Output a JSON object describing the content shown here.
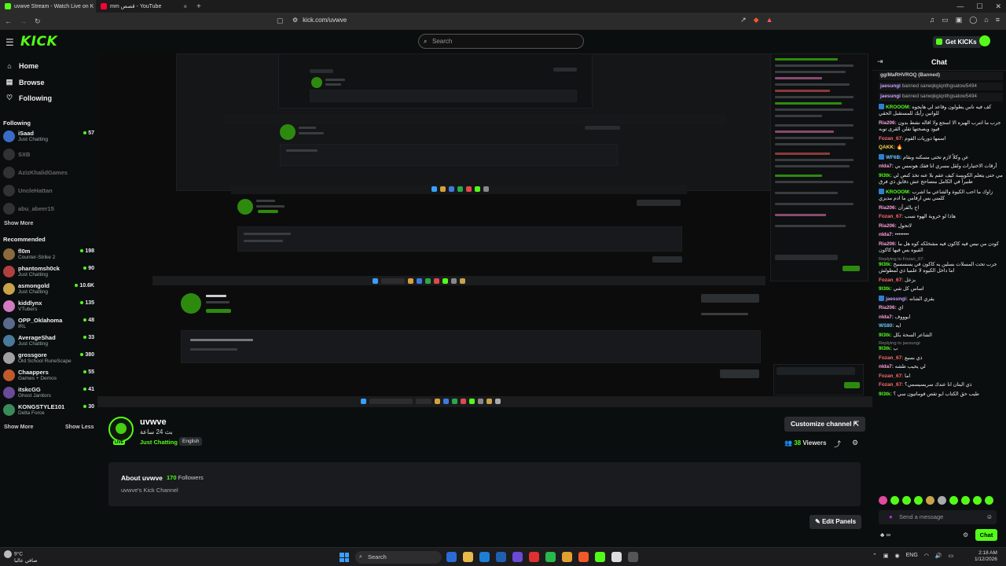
{
  "browser": {
    "tabs": [
      {
        "title": "uvwve Stream - Watch Live on K",
        "color": "#53fc18"
      },
      {
        "title": "mm قصص - YouTube",
        "color": "#ff0033"
      }
    ],
    "url": "kick.com/uvwve"
  },
  "header": {
    "logo": "KICK",
    "search_placeholder": "Search",
    "get_kicks": "Get KICKs"
  },
  "sidebar": {
    "nav": [
      {
        "label": "Home",
        "icon": "home-icon"
      },
      {
        "label": "Browse",
        "icon": "browse-icon"
      },
      {
        "label": "Following",
        "icon": "heart-icon"
      }
    ],
    "following_title": "Following",
    "following": [
      {
        "name": "iSaad",
        "category": "Just Chatting",
        "viewers": "57",
        "live": true,
        "color": "#3a6bc9"
      },
      {
        "name": "SXB",
        "category": "",
        "viewers": "",
        "live": false,
        "color": "#777"
      },
      {
        "name": "AzizKhalidGames",
        "category": "",
        "viewers": "",
        "live": false,
        "color": "#777"
      },
      {
        "name": "UncleHattan",
        "category": "",
        "viewers": "",
        "live": false,
        "color": "#777"
      },
      {
        "name": "abu_abeer15",
        "category": "",
        "viewers": "",
        "live": false,
        "color": "#777"
      }
    ],
    "show_more": "Show More",
    "recommended_title": "Recommended",
    "recommended": [
      {
        "name": "fl0m",
        "category": "Counter-Strike 2",
        "viewers": "198",
        "color": "#8a6a3a"
      },
      {
        "name": "phantomsh0ck",
        "category": "Just Chatting",
        "viewers": "90",
        "color": "#b04040"
      },
      {
        "name": "asmongold",
        "category": "Just Chatting",
        "viewers": "10.6K",
        "color": "#c9a24a"
      },
      {
        "name": "kiddlynx",
        "category": "VTubers",
        "viewers": "135",
        "color": "#d07ac0"
      },
      {
        "name": "OPP_Oklahoma",
        "category": "IRL",
        "viewers": "48",
        "color": "#5a6a8a"
      },
      {
        "name": "AverageShad",
        "category": "Just Chatting",
        "viewers": "33",
        "color": "#4a7a9a"
      },
      {
        "name": "grossgore",
        "category": "Old School RuneScape",
        "viewers": "380",
        "color": "#a0a0a0"
      },
      {
        "name": "Chaappers",
        "category": "Games + Demos",
        "viewers": "55",
        "color": "#c05a2a"
      },
      {
        "name": "itskcGG",
        "category": "Ghost Janitors",
        "viewers": "41",
        "color": "#6a4a9a"
      },
      {
        "name": "KONGSTYLE101",
        "category": "Delta Force",
        "viewers": "30",
        "color": "#3a8a5a"
      }
    ],
    "show_more_2": "Show More",
    "show_less": "Show Less"
  },
  "channel": {
    "name": "uvwve",
    "title": "بث 24 ساعة",
    "category": "Just Chatting",
    "language": "English",
    "live_badge": "LIVE",
    "customize": "Customize channel",
    "viewers_count": "38",
    "viewers_label": "Viewers",
    "about_title": "About uvwve",
    "followers_count": "170",
    "followers_label": "Followers",
    "about_desc": "uvwve's Kick Channel",
    "edit_panels": "Edit Panels"
  },
  "chat": {
    "title": "Chat",
    "messages": [
      {
        "user": "gg/MaRHVROQ (Banned)",
        "text": "",
        "color": "#cfcfcf",
        "system": true
      },
      {
        "user": "jaesungi",
        "text": "banned sarwqkgiqnthgsatow5494",
        "color": "#c9a0ff",
        "system": true
      },
      {
        "user": "jaesungi",
        "text": "banned sarwqkgiqnthgsatow5494",
        "color": "#c9a0ff",
        "system": true
      },
      {
        "user": "KROOOM:",
        "text": "كف فيه ناس يطولون وقاعد لي هايجوه للوانين رأيك للمستقبل الحقي",
        "color": "#53fc18",
        "badge": true
      },
      {
        "user": "Ria206:",
        "text": "جرب ما اتنرب الهيزه الا اسجع ولا اقاله نشط بدون قيود وبصحتها تقلن القرى توبه",
        "color": "#ff9fdc"
      },
      {
        "user": "Fozan_67:",
        "text": "اسمها دوريات القوم",
        "color": "#ff6b6b"
      },
      {
        "user": "QAKK:",
        "text": "🔥",
        "color": "#ffd84a"
      },
      {
        "user": "WF6B:",
        "text": "عن وكلاً لازم تختى مسكنه وبقام",
        "color": "#6ac7ff",
        "badge": true
      },
      {
        "user": "nIda7:",
        "text": "أرقات الاختيارات ولقل مسري انا فقك هونمس بي",
        "color": "#ff9fdc"
      },
      {
        "user": "9l3tk:",
        "text": "مي حتى يتعلم الكويسة كيف عقم بلا عنه تخذ كنص لي ظنيراً في الكامل متصاحج عش دقايق ذي فرق",
        "color": "#53fc18"
      },
      {
        "user": "KROOOM:",
        "text": "زاوك ما احب الكيوة والشاعي ما اشرب كلمني بس ارقامن ما ادم مديزي",
        "color": "#53fc18",
        "badge": true
      },
      {
        "user": "Ria206:",
        "text": "اج بالقرآن",
        "color": "#ff9fdc"
      },
      {
        "user": "Fozan_67:",
        "text": "هاذا لو خروبة الهوء نسب",
        "color": "#ff6b6b"
      },
      {
        "user": "Ria206:",
        "text": "لاتحول",
        "color": "#ff9fdc"
      },
      {
        "user": "nIda7:",
        "text": "••••••••",
        "color": "#ff9fdc"
      },
      {
        "user": "Ria206:",
        "text": "كودن من نيس فيه كاكون فيه مشخلكه كوه هل ما القيوه بس فيها كاكون",
        "color": "#ff9fdc"
      },
      {
        "user": "9l3tk:",
        "text": "جرب تحت المسلات بسلين يه كاكون في يسسسيح اما داخل الكيوه لا علميا ذي لمطولش",
        "color": "#53fc18",
        "reply": "Replying to Fozan_67:"
      },
      {
        "user": "Fozan_67:",
        "text": "بزعل",
        "color": "#ff6b6b"
      },
      {
        "user": "9l3tk:",
        "text": "اساس كل شي",
        "color": "#53fc18"
      },
      {
        "user": "jaesungi:",
        "text": "يقري الشانه",
        "color": "#c9a0ff",
        "badge": true
      },
      {
        "user": "Ria206:",
        "text": "اي",
        "color": "#ff9fdc"
      },
      {
        "user": "nIda7:",
        "text": "ايوووف",
        "color": "#ff9fdc"
      },
      {
        "user": "WS80:",
        "text": "ايه",
        "color": "#6ac7ff"
      },
      {
        "user": "9l3tk:",
        "text": "الشاعر السحة بكل",
        "color": "#53fc18"
      },
      {
        "user": "9l3tk:",
        "text": "ب",
        "color": "#53fc18",
        "reply": "Replying to jaesungi:"
      },
      {
        "user": "Fozan_67:",
        "text": "ذي بسيع",
        "color": "#ff6b6b"
      },
      {
        "user": "nIda7:",
        "text": "لي يحيب طشه",
        "color": "#ff9fdc"
      },
      {
        "user": "Fozan_67:",
        "text": "اما",
        "color": "#ff6b6b"
      },
      {
        "user": "Fozan_67:",
        "text": "ذي البتان انا عندك سريسيسمي؟",
        "color": "#ff6b6b"
      },
      {
        "user": "9l3tk:",
        "text": "طيب حق الكتاب ابو تقص فوماتيون سي ؟",
        "color": "#53fc18"
      }
    ],
    "input_placeholder": "Send a message",
    "send": "Chat",
    "footer": "∞"
  },
  "taskbar": {
    "temp": "9°C",
    "weather": "صافي عالبا",
    "search": "Search",
    "lang": "ENG",
    "time": "2:18 AM",
    "date": "1/12/2026"
  }
}
